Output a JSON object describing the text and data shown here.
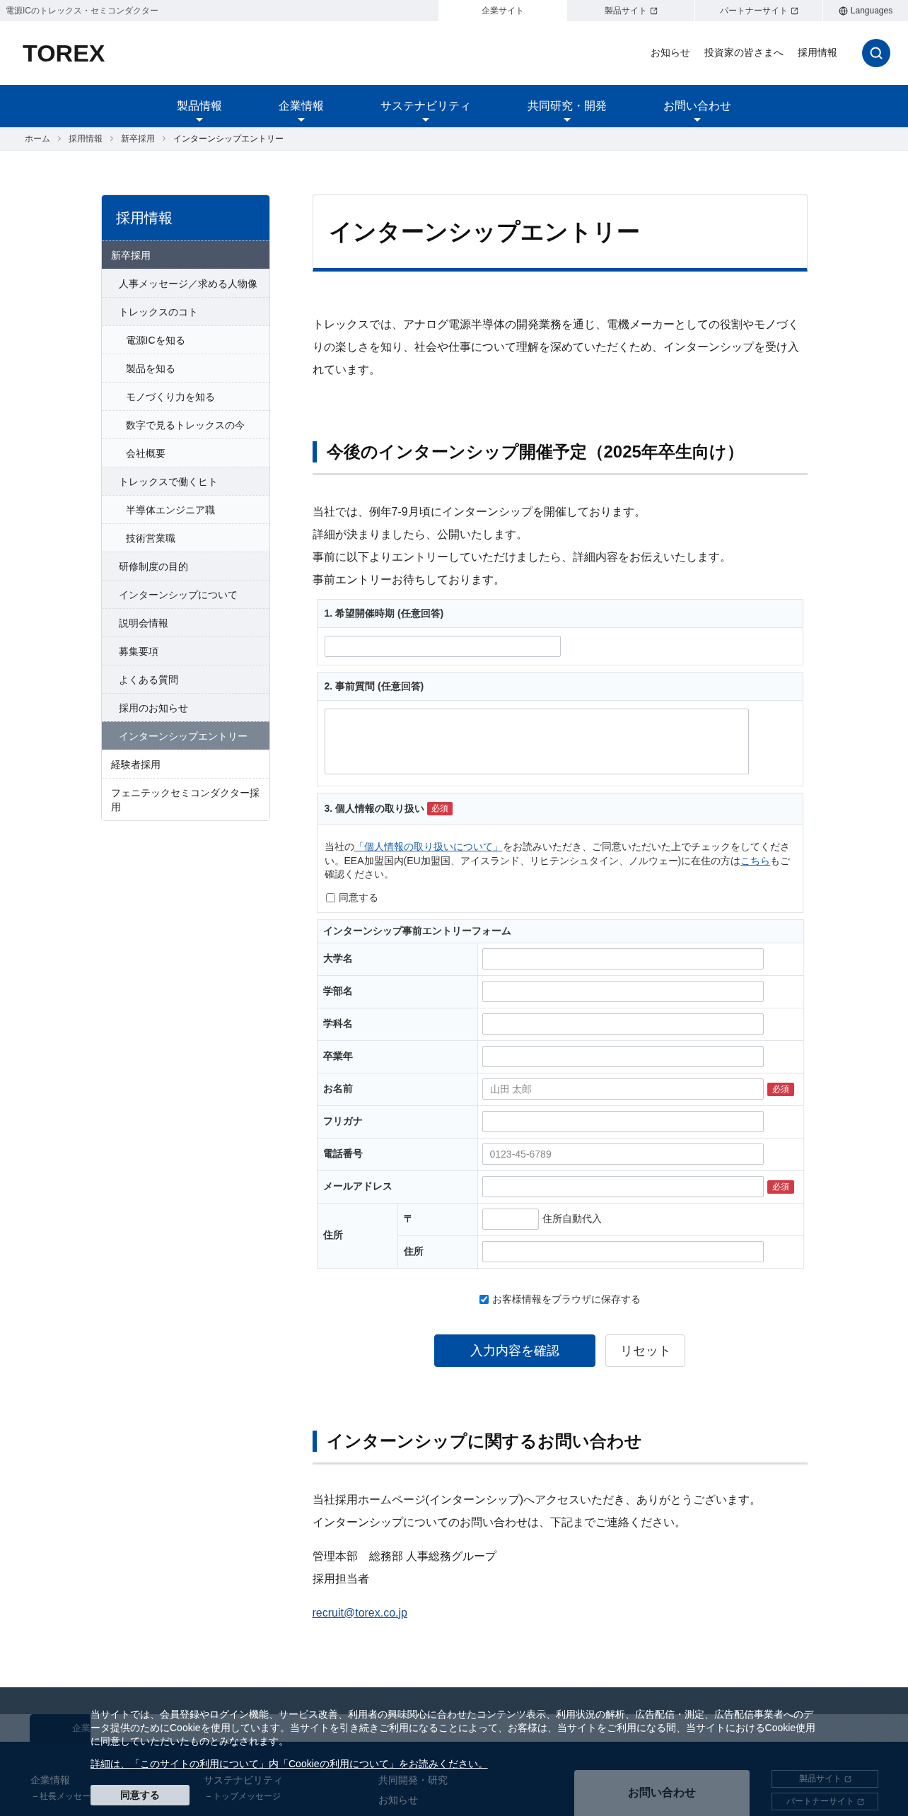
{
  "top_bar": {
    "tagline": "電源ICのトレックス・セミコンダクター",
    "sites": [
      {
        "label": "企業サイト",
        "selected": true,
        "external": false
      },
      {
        "label": "製品サイト",
        "selected": false,
        "external": true
      },
      {
        "label": "パートナーサイト",
        "selected": false,
        "external": true
      }
    ],
    "languages": "Languages"
  },
  "header": {
    "logo": "TOREX",
    "links": [
      "お知らせ",
      "投資家の皆さまへ",
      "採用情報"
    ]
  },
  "main_nav": [
    "製品情報",
    "企業情報",
    "サステナビリティ",
    "共同研究・開発",
    "お問い合わせ"
  ],
  "breadcrumb": [
    "ホーム",
    "採用情報",
    "新卒採用",
    "インターンシップエントリー"
  ],
  "sidebar": {
    "title": "採用情報",
    "items": [
      {
        "label": "新卒採用",
        "selected": false,
        "children": [
          {
            "label": "人事メッセージ／求める人物像",
            "selected": false
          },
          {
            "label": "トレックスのコト",
            "selected": false,
            "children": [
              {
                "label": "電源ICを知る",
                "selected": false
              },
              {
                "label": "製品を知る",
                "selected": false
              },
              {
                "label": "モノづくり力を知る",
                "selected": false
              },
              {
                "label": "数字で見るトレックスの今",
                "selected": false
              },
              {
                "label": "会社概要",
                "selected": false
              }
            ]
          },
          {
            "label": "トレックスで働くヒト",
            "selected": false,
            "children": [
              {
                "label": "半導体エンジニア職",
                "selected": false
              },
              {
                "label": "技術営業職",
                "selected": false
              }
            ]
          },
          {
            "label": "研修制度の目的",
            "selected": false
          },
          {
            "label": "インターンシップについて",
            "selected": false
          },
          {
            "label": "説明会情報",
            "selected": false
          },
          {
            "label": "募集要項",
            "selected": false
          },
          {
            "label": "よくある質問",
            "selected": false
          },
          {
            "label": "採用のお知らせ",
            "selected": false
          },
          {
            "label": "インターンシップエントリー",
            "selected": true
          }
        ]
      },
      {
        "label": "経験者採用",
        "selected": false
      },
      {
        "label": "フェニテックセミコンダクター採用",
        "selected": false
      }
    ]
  },
  "page_title": "インターンシップエントリー",
  "intro": "トレックスでは、アナログ電源半導体の開発業務を通じ、電機メーカーとしての役割やモノづくりの楽しさを知り、社会や仕事について理解を深めていただくため、インターンシップを受け入れています。",
  "schedule": {
    "heading": "今後のインターンシップ開催予定（2025年卒生向け）",
    "lines": [
      "当社では、例年7-9月頃にインターンシップを開催しております。",
      "詳細が決まりましたら、公開いたします。",
      "事前に以下よりエントリーしていただけましたら、詳細内容をお伝えいたします。",
      "事前エントリーお待ちしております。"
    ]
  },
  "questions": [
    {
      "kind": "input",
      "label": "1. 希望開催時期 (任意回答)"
    },
    {
      "kind": "textarea",
      "label": "2. 事前質問 (任意回答)"
    },
    {
      "kind": "consent",
      "label": "3. 個人情報の取り扱い",
      "badge": "必須",
      "text": [
        {
          "kind": "text",
          "text": "当社の"
        },
        {
          "kind": "link",
          "text": "「個人情報の取り扱いについて」"
        },
        {
          "kind": "text",
          "text": "をお読みいただき、ご同意いただいた上でチェックをしてください。EEA加盟国内(EU加盟国、アイスランド、リヒテンシュタイン、ノルウェー)に在住の方は"
        },
        {
          "kind": "link",
          "text": "こちら"
        },
        {
          "kind": "text",
          "text": "もご確認ください。"
        }
      ],
      "agree": {
        "label": "同意する",
        "checked": false
      }
    }
  ],
  "entry_form": {
    "title": "インターンシップ事前エントリーフォーム",
    "rows": [
      {
        "kind": "field",
        "label": "大学名"
      },
      {
        "kind": "field",
        "label": "学部名"
      },
      {
        "kind": "field",
        "label": "学科名"
      },
      {
        "kind": "field",
        "label": "卒業年"
      },
      {
        "kind": "field",
        "label": "お名前",
        "placeholder": "山田 太郎",
        "badge": "必須"
      },
      {
        "kind": "field",
        "label": "フリガナ"
      },
      {
        "kind": "field",
        "label": "電話番号",
        "placeholder": "0123-45-6789"
      },
      {
        "kind": "field",
        "label": "メールアドレス",
        "badge": "必須"
      },
      {
        "kind": "group",
        "label": "住所",
        "children": [
          {
            "kind": "postal",
            "label": "〒",
            "note": "住所自動代入"
          },
          {
            "kind": "field",
            "label": "住所"
          }
        ]
      }
    ]
  },
  "save_info": {
    "label": "お客様情報をブラウザに保存する",
    "checked": true
  },
  "buttons": [
    {
      "kind": "primary",
      "label": "入力内容を確認"
    },
    {
      "kind": "secondary",
      "label": "リセット"
    }
  ],
  "contact": {
    "heading": "インターンシップに関するお問い合わせ",
    "paragraphs": [
      [
        "当社採用ホームページ(インターンシップ)へアクセスいただき、ありがとうございます。",
        "インターンシップについてのお問い合わせは、下記までご連絡ください。"
      ],
      [
        "管理本部　総務部 人事総務グループ",
        "採用担当者"
      ]
    ],
    "email": "recruit@torex.co.jp"
  },
  "footer": {
    "tab": "企業",
    "columns": [
      {
        "headings": [
          "企業情報"
        ],
        "links": [
          "社長メッセー"
        ]
      },
      {
        "headings": [
          "サステナビリティ"
        ],
        "links": [
          "トップメッセージ"
        ]
      },
      {
        "headings": [
          "共同開発・研究",
          "お知らせ"
        ]
      }
    ],
    "contact_button": "お問い合わせ",
    "sites": [
      "製品サイト",
      "パートナーサイト"
    ]
  },
  "cookie_banner": {
    "text": "当サイトでは、会員登録やログイン機能、サービス改善、利用者の興味関心に合わせたコンテンツ表示、利用状況の解析、広告配信・測定、広告配信事業者へのデータ提供のためにCookieを使用しています。当サイトを引き続きご利用になることによって、お客様は、当サイトをご利用になる間、当サイトにおけるCookie使用に同意していただいたものとみなされます。",
    "details_link": "詳細は、「このサイトの利用について」内「Cookieの利用について」をお読みください。",
    "accept_button": "同意する"
  }
}
